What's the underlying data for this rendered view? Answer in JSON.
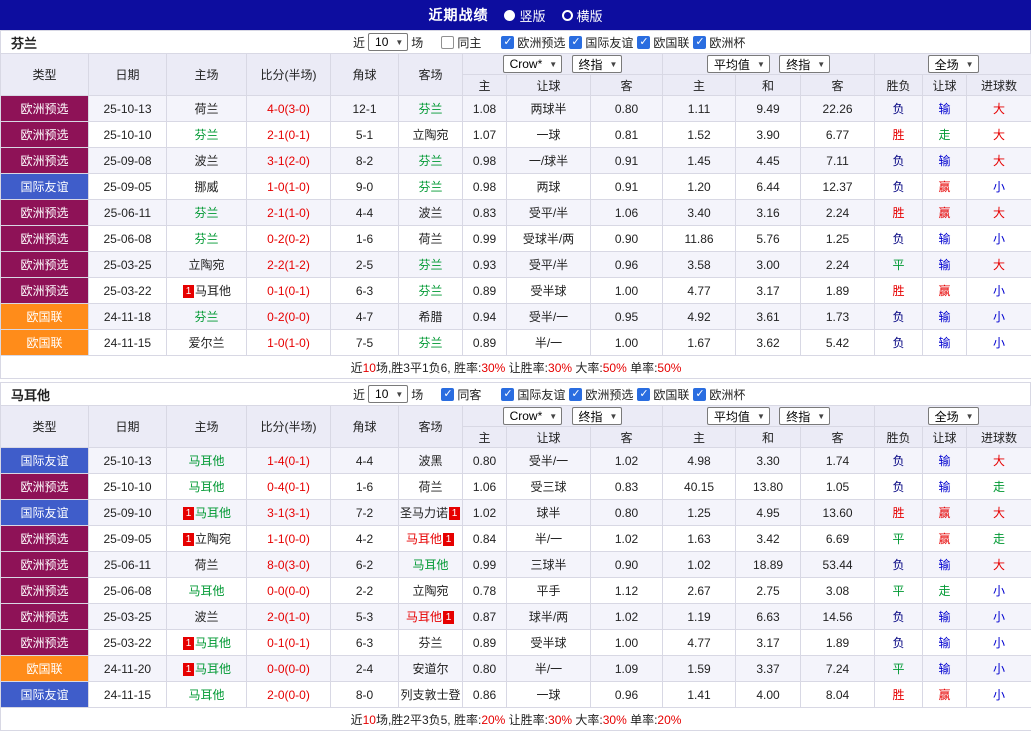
{
  "topbar": {
    "title": "近期战绩",
    "vertical_label": "竖版",
    "horizontal_label": "横版",
    "vertical_selected": true,
    "horizontal_selected": false
  },
  "colors": {
    "topbar_bg": "#0d0d9f",
    "badge_euro_qualifier": "#8e1257",
    "badge_friendly": "#3f5dca",
    "badge_nations_league": "#ff8c1a",
    "team_green": "#009933",
    "alert_red": "#e60000",
    "odds_blue": "#0000d0",
    "result_navy": "#000080",
    "checkbox_blue": "#2a6de0",
    "header_bg": "#ebebf6",
    "row_alt_bg": "#f4f4fb"
  },
  "table_header": {
    "cols": [
      "类型",
      "日期",
      "主场",
      "比分(半场)",
      "角球",
      "客场"
    ],
    "subcols": [
      "主",
      "让球",
      "客",
      "主",
      "和",
      "客",
      "胜负",
      "让球",
      "进球数"
    ],
    "dd_crow": "Crow*",
    "dd_final": "终指",
    "dd_avg": "平均值",
    "dd_final2": "终指",
    "dd_full": "全场"
  },
  "sections": [
    {
      "team": "芬兰",
      "filter": {
        "near": "近",
        "count": "10",
        "games": "场",
        "same_label": "同主",
        "same_checked": false,
        "competitions": [
          "欧洲预选",
          "国际友谊",
          "欧国联",
          "欧洲杯"
        ]
      },
      "rows": [
        {
          "t": "欧洲预选",
          "tk": "eq",
          "d": "25-10-13",
          "h": {
            "n": "荷兰",
            "c": "k"
          },
          "s": "4-0(3-0)",
          "cn": "12-1",
          "a": {
            "n": "芬兰",
            "c": "g"
          },
          "o1": [
            "1.08",
            "两球半",
            "0.80"
          ],
          "o2": [
            "1.11",
            "9.49",
            "22.26"
          ],
          "res": [
            "负",
            "n"
          ],
          "let": [
            "输",
            "b"
          ],
          "gl": [
            "大",
            "r"
          ]
        },
        {
          "t": "欧洲预选",
          "tk": "eq",
          "d": "25-10-10",
          "h": {
            "n": "芬兰",
            "c": "g"
          },
          "s": "2-1(0-1)",
          "cn": "5-1",
          "a": {
            "n": "立陶宛",
            "c": "k"
          },
          "o1": [
            "1.07",
            "一球",
            "0.81"
          ],
          "o2": [
            "1.52",
            "3.90",
            "6.77"
          ],
          "res": [
            "胜",
            "r"
          ],
          "let": [
            "走",
            "g"
          ],
          "gl": [
            "大",
            "r"
          ]
        },
        {
          "t": "欧洲预选",
          "tk": "eq",
          "d": "25-09-08",
          "h": {
            "n": "波兰",
            "c": "k"
          },
          "s": "3-1(2-0)",
          "cn": "8-2",
          "a": {
            "n": "芬兰",
            "c": "g"
          },
          "o1": [
            "0.98",
            "一/球半",
            "0.91"
          ],
          "o2": [
            "1.45",
            "4.45",
            "7.11"
          ],
          "res": [
            "负",
            "n"
          ],
          "let": [
            "输",
            "b"
          ],
          "gl": [
            "大",
            "r"
          ]
        },
        {
          "t": "国际友谊",
          "tk": "fr",
          "d": "25-09-05",
          "h": {
            "n": "挪威",
            "c": "k"
          },
          "s": "1-0(1-0)",
          "cn": "9-0",
          "a": {
            "n": "芬兰",
            "c": "g"
          },
          "o1": [
            "0.98",
            "两球",
            "0.91"
          ],
          "o2": [
            "1.20",
            "6.44",
            "12.37"
          ],
          "res": [
            "负",
            "n"
          ],
          "let": [
            "赢",
            "r"
          ],
          "gl": [
            "小",
            "b"
          ]
        },
        {
          "t": "欧洲预选",
          "tk": "eq",
          "d": "25-06-11",
          "h": {
            "n": "芬兰",
            "c": "g"
          },
          "s": "2-1(1-0)",
          "cn": "4-4",
          "a": {
            "n": "波兰",
            "c": "k"
          },
          "o1": [
            "0.83",
            "受平/半",
            "1.06"
          ],
          "o2": [
            "3.40",
            "3.16",
            "2.24"
          ],
          "res": [
            "胜",
            "r"
          ],
          "let": [
            "赢",
            "r"
          ],
          "gl": [
            "大",
            "r"
          ]
        },
        {
          "t": "欧洲预选",
          "tk": "eq",
          "d": "25-06-08",
          "h": {
            "n": "芬兰",
            "c": "g"
          },
          "s": "0-2(0-2)",
          "cn": "1-6",
          "a": {
            "n": "荷兰",
            "c": "k"
          },
          "o1": [
            "0.99",
            "受球半/两",
            "0.90"
          ],
          "o2": [
            "11.86",
            "5.76",
            "1.25"
          ],
          "res": [
            "负",
            "n"
          ],
          "let": [
            "输",
            "b"
          ],
          "gl": [
            "小",
            "b"
          ]
        },
        {
          "t": "欧洲预选",
          "tk": "eq",
          "d": "25-03-25",
          "h": {
            "n": "立陶宛",
            "c": "k"
          },
          "s": "2-2(1-2)",
          "cn": "2-5",
          "a": {
            "n": "芬兰",
            "c": "g"
          },
          "o1": [
            "0.93",
            "受平/半",
            "0.96"
          ],
          "o2": [
            "3.58",
            "3.00",
            "2.24"
          ],
          "res": [
            "平",
            "g"
          ],
          "let": [
            "输",
            "b"
          ],
          "gl": [
            "大",
            "r"
          ]
        },
        {
          "t": "欧洲预选",
          "tk": "eq",
          "d": "25-03-22",
          "h": {
            "n": "马耳他",
            "c": "k",
            "b": "pre"
          },
          "s": "0-1(0-1)",
          "cn": "6-3",
          "a": {
            "n": "芬兰",
            "c": "g"
          },
          "o1": [
            "0.89",
            "受半球",
            "1.00"
          ],
          "o2": [
            "4.77",
            "3.17",
            "1.89"
          ],
          "res": [
            "胜",
            "r"
          ],
          "let": [
            "赢",
            "r"
          ],
          "gl": [
            "小",
            "b"
          ]
        },
        {
          "t": "欧国联",
          "tk": "nl",
          "d": "24-11-18",
          "h": {
            "n": "芬兰",
            "c": "g"
          },
          "s": "0-2(0-0)",
          "cn": "4-7",
          "a": {
            "n": "希腊",
            "c": "k"
          },
          "o1": [
            "0.94",
            "受半/一",
            "0.95"
          ],
          "o2": [
            "4.92",
            "3.61",
            "1.73"
          ],
          "res": [
            "负",
            "n"
          ],
          "let": [
            "输",
            "b"
          ],
          "gl": [
            "小",
            "b"
          ]
        },
        {
          "t": "欧国联",
          "tk": "nl",
          "d": "24-11-15",
          "h": {
            "n": "爱尔兰",
            "c": "k"
          },
          "s": "1-0(1-0)",
          "cn": "7-5",
          "a": {
            "n": "芬兰",
            "c": "g"
          },
          "o1": [
            "0.89",
            "半/一",
            "1.00"
          ],
          "o2": [
            "1.67",
            "3.62",
            "5.42"
          ],
          "res": [
            "负",
            "n"
          ],
          "let": [
            "输",
            "b"
          ],
          "gl": [
            "小",
            "b"
          ]
        }
      ],
      "summary": {
        "parts": [
          "近",
          "10",
          "场,胜3平1负6, 胜率:",
          "30%",
          " 让胜率:",
          "30%",
          " 大率:",
          "50%",
          " 单率:",
          "50%"
        ]
      }
    },
    {
      "team": "马耳他",
      "filter": {
        "near": "近",
        "count": "10",
        "games": "场",
        "same_label": "同客",
        "same_checked": true,
        "competitions": [
          "国际友谊",
          "欧洲预选",
          "欧国联",
          "欧洲杯"
        ]
      },
      "rows": [
        {
          "t": "国际友谊",
          "tk": "fr",
          "d": "25-10-13",
          "h": {
            "n": "马耳他",
            "c": "g"
          },
          "s": "1-4(0-1)",
          "cn": "4-4",
          "a": {
            "n": "波黑",
            "c": "k"
          },
          "o1": [
            "0.80",
            "受半/一",
            "1.02"
          ],
          "o2": [
            "4.98",
            "3.30",
            "1.74"
          ],
          "res": [
            "负",
            "n"
          ],
          "let": [
            "输",
            "b"
          ],
          "gl": [
            "大",
            "r"
          ]
        },
        {
          "t": "欧洲预选",
          "tk": "eq",
          "d": "25-10-10",
          "h": {
            "n": "马耳他",
            "c": "g"
          },
          "s": "0-4(0-1)",
          "cn": "1-6",
          "a": {
            "n": "荷兰",
            "c": "k"
          },
          "o1": [
            "1.06",
            "受三球",
            "0.83"
          ],
          "o2": [
            "40.15",
            "13.80",
            "1.05"
          ],
          "res": [
            "负",
            "n"
          ],
          "let": [
            "输",
            "b"
          ],
          "gl": [
            "走",
            "g"
          ]
        },
        {
          "t": "国际友谊",
          "tk": "fr",
          "d": "25-09-10",
          "h": {
            "n": "马耳他",
            "c": "g",
            "b": "pre"
          },
          "s": "3-1(3-1)",
          "cn": "7-2",
          "a": {
            "n": "圣马力诺",
            "c": "k",
            "b": "post"
          },
          "o1": [
            "1.02",
            "球半",
            "0.80"
          ],
          "o2": [
            "1.25",
            "4.95",
            "13.60"
          ],
          "res": [
            "胜",
            "r"
          ],
          "let": [
            "赢",
            "r"
          ],
          "gl": [
            "大",
            "r"
          ]
        },
        {
          "t": "欧洲预选",
          "tk": "eq",
          "d": "25-09-05",
          "h": {
            "n": "立陶宛",
            "c": "k",
            "b": "pre"
          },
          "s": "1-1(0-0)",
          "cn": "4-2",
          "a": {
            "n": "马耳他",
            "c": "r",
            "b": "post"
          },
          "o1": [
            "0.84",
            "半/一",
            "1.02"
          ],
          "o2": [
            "1.63",
            "3.42",
            "6.69"
          ],
          "res": [
            "平",
            "g"
          ],
          "let": [
            "赢",
            "r"
          ],
          "gl": [
            "走",
            "g"
          ]
        },
        {
          "t": "欧洲预选",
          "tk": "eq",
          "d": "25-06-11",
          "h": {
            "n": "荷兰",
            "c": "k"
          },
          "s": "8-0(3-0)",
          "cn": "6-2",
          "a": {
            "n": "马耳他",
            "c": "g"
          },
          "o1": [
            "0.99",
            "三球半",
            "0.90"
          ],
          "o2": [
            "1.02",
            "18.89",
            "53.44"
          ],
          "res": [
            "负",
            "n"
          ],
          "let": [
            "输",
            "b"
          ],
          "gl": [
            "大",
            "r"
          ]
        },
        {
          "t": "欧洲预选",
          "tk": "eq",
          "d": "25-06-08",
          "h": {
            "n": "马耳他",
            "c": "g"
          },
          "s": "0-0(0-0)",
          "cn": "2-2",
          "a": {
            "n": "立陶宛",
            "c": "k"
          },
          "o1": [
            "0.78",
            "平手",
            "1.12"
          ],
          "o2": [
            "2.67",
            "2.75",
            "3.08"
          ],
          "res": [
            "平",
            "g"
          ],
          "let": [
            "走",
            "g"
          ],
          "gl": [
            "小",
            "b"
          ]
        },
        {
          "t": "欧洲预选",
          "tk": "eq",
          "d": "25-03-25",
          "h": {
            "n": "波兰",
            "c": "k"
          },
          "s": "2-0(1-0)",
          "cn": "5-3",
          "a": {
            "n": "马耳他",
            "c": "r",
            "b": "post"
          },
          "o1": [
            "0.87",
            "球半/两",
            "1.02"
          ],
          "o2": [
            "1.19",
            "6.63",
            "14.56"
          ],
          "res": [
            "负",
            "n"
          ],
          "let": [
            "输",
            "b"
          ],
          "gl": [
            "小",
            "b"
          ]
        },
        {
          "t": "欧洲预选",
          "tk": "eq",
          "d": "25-03-22",
          "h": {
            "n": "马耳他",
            "c": "g",
            "b": "pre"
          },
          "s": "0-1(0-1)",
          "cn": "6-3",
          "a": {
            "n": "芬兰",
            "c": "k"
          },
          "o1": [
            "0.89",
            "受半球",
            "1.00"
          ],
          "o2": [
            "4.77",
            "3.17",
            "1.89"
          ],
          "res": [
            "负",
            "n"
          ],
          "let": [
            "输",
            "b"
          ],
          "gl": [
            "小",
            "b"
          ]
        },
        {
          "t": "欧国联",
          "tk": "nl",
          "d": "24-11-20",
          "h": {
            "n": "马耳他",
            "c": "g",
            "b": "pre"
          },
          "s": "0-0(0-0)",
          "cn": "2-4",
          "a": {
            "n": "安道尔",
            "c": "k"
          },
          "o1": [
            "0.80",
            "半/一",
            "1.09"
          ],
          "o2": [
            "1.59",
            "3.37",
            "7.24"
          ],
          "res": [
            "平",
            "g"
          ],
          "let": [
            "输",
            "b"
          ],
          "gl": [
            "小",
            "b"
          ]
        },
        {
          "t": "国际友谊",
          "tk": "fr",
          "d": "24-11-15",
          "h": {
            "n": "马耳他",
            "c": "g"
          },
          "s": "2-0(0-0)",
          "cn": "8-0",
          "a": {
            "n": "列支敦士登",
            "c": "k"
          },
          "o1": [
            "0.86",
            "一球",
            "0.96"
          ],
          "o2": [
            "1.41",
            "4.00",
            "8.04"
          ],
          "res": [
            "胜",
            "r"
          ],
          "let": [
            "赢",
            "r"
          ],
          "gl": [
            "小",
            "b"
          ]
        }
      ],
      "summary": {
        "parts": [
          "近",
          "10",
          "场,胜2平3负5, 胜率:",
          "20%",
          " 让胜率:",
          "30%",
          " 大率:",
          "30%",
          " 单率:",
          "20%"
        ]
      }
    }
  ]
}
